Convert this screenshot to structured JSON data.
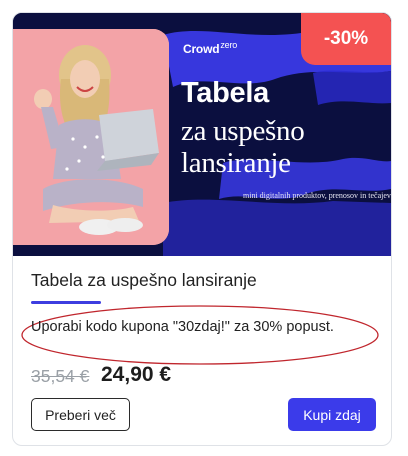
{
  "product": {
    "banner": {
      "brand_name": "Crowd",
      "brand_suffix": "zero",
      "headline_line1": "Tabela",
      "headline_line2": "za uspešno",
      "headline_line3": "lansiranje",
      "subheadline": "mini digitalnih produktov, prenosov in tečajev!",
      "discount_badge": "-30%",
      "colors": {
        "navy": "#0b0f3f",
        "brush_blue": "#3a3ae6",
        "photo_pink": "#f3a3a7",
        "badge_red": "#f45252"
      }
    },
    "title": "Tabela za uspešno lansiranje",
    "coupon_text": "Uporabi kodo kupona \"30zdaj!\" za 30% popust.",
    "old_price": "35,54 €",
    "new_price": "24,90 €",
    "actions": {
      "details_label": "Preberi več",
      "buy_label": "Kupi zdaj"
    },
    "accent_color": "#3d3de0",
    "annotation_color": "#c0262d"
  }
}
